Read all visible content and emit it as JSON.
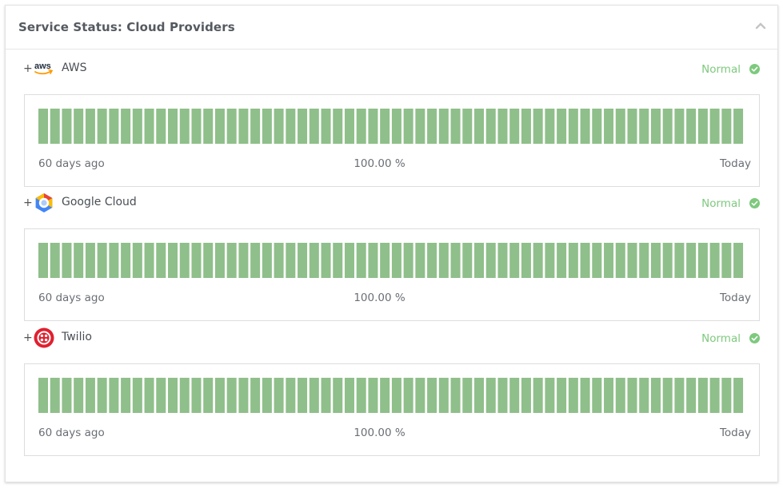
{
  "panel": {
    "title": "Service Status: Cloud Providers"
  },
  "colors": {
    "bar": "#8fbf8a",
    "status_normal": "#7ec97e"
  },
  "services": [
    {
      "toggle": "+",
      "name": "AWS",
      "logo_icon": "aws-icon",
      "logo_text": "aws",
      "status": "Normal",
      "uptime_days": 60,
      "label_start": "60 days ago",
      "label_uptime": "100.00 %",
      "label_end": "Today"
    },
    {
      "toggle": "+",
      "name": "Google Cloud",
      "logo_icon": "google-cloud-icon",
      "status": "Normal",
      "uptime_days": 60,
      "label_start": "60 days ago",
      "label_uptime": "100.00 %",
      "label_end": "Today"
    },
    {
      "toggle": "+",
      "name": "Twilio",
      "logo_icon": "twilio-icon",
      "status": "Normal",
      "uptime_days": 60,
      "label_start": "60 days ago",
      "label_uptime": "100.00 %",
      "label_end": "Today"
    }
  ]
}
